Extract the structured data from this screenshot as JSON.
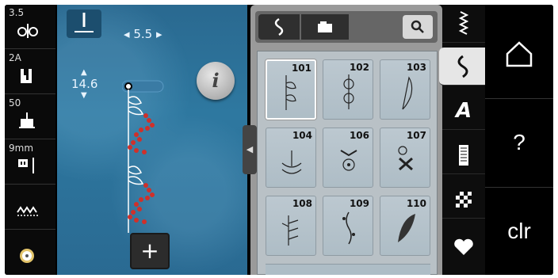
{
  "status": {
    "needle_position": "3.5",
    "presser_foot": "2A",
    "tension": "50",
    "needle_size": "9mm"
  },
  "stitch_settings": {
    "width_value": "5.5",
    "length_value": "14.6"
  },
  "buttons": {
    "info_label": "i",
    "add_label": "+",
    "clear_label": "clr",
    "help_label": "?"
  },
  "stitches": [
    {
      "number": "101",
      "selected": true
    },
    {
      "number": "102",
      "selected": false
    },
    {
      "number": "103",
      "selected": false
    },
    {
      "number": "104",
      "selected": false
    },
    {
      "number": "106",
      "selected": false
    },
    {
      "number": "107",
      "selected": false
    },
    {
      "number": "108",
      "selected": false
    },
    {
      "number": "109",
      "selected": false
    },
    {
      "number": "110",
      "selected": false
    }
  ],
  "colors": {
    "accent_blue": "#2e78a0",
    "stitch_red": "#d0302a",
    "panel_grey": "#9a9a9a"
  }
}
